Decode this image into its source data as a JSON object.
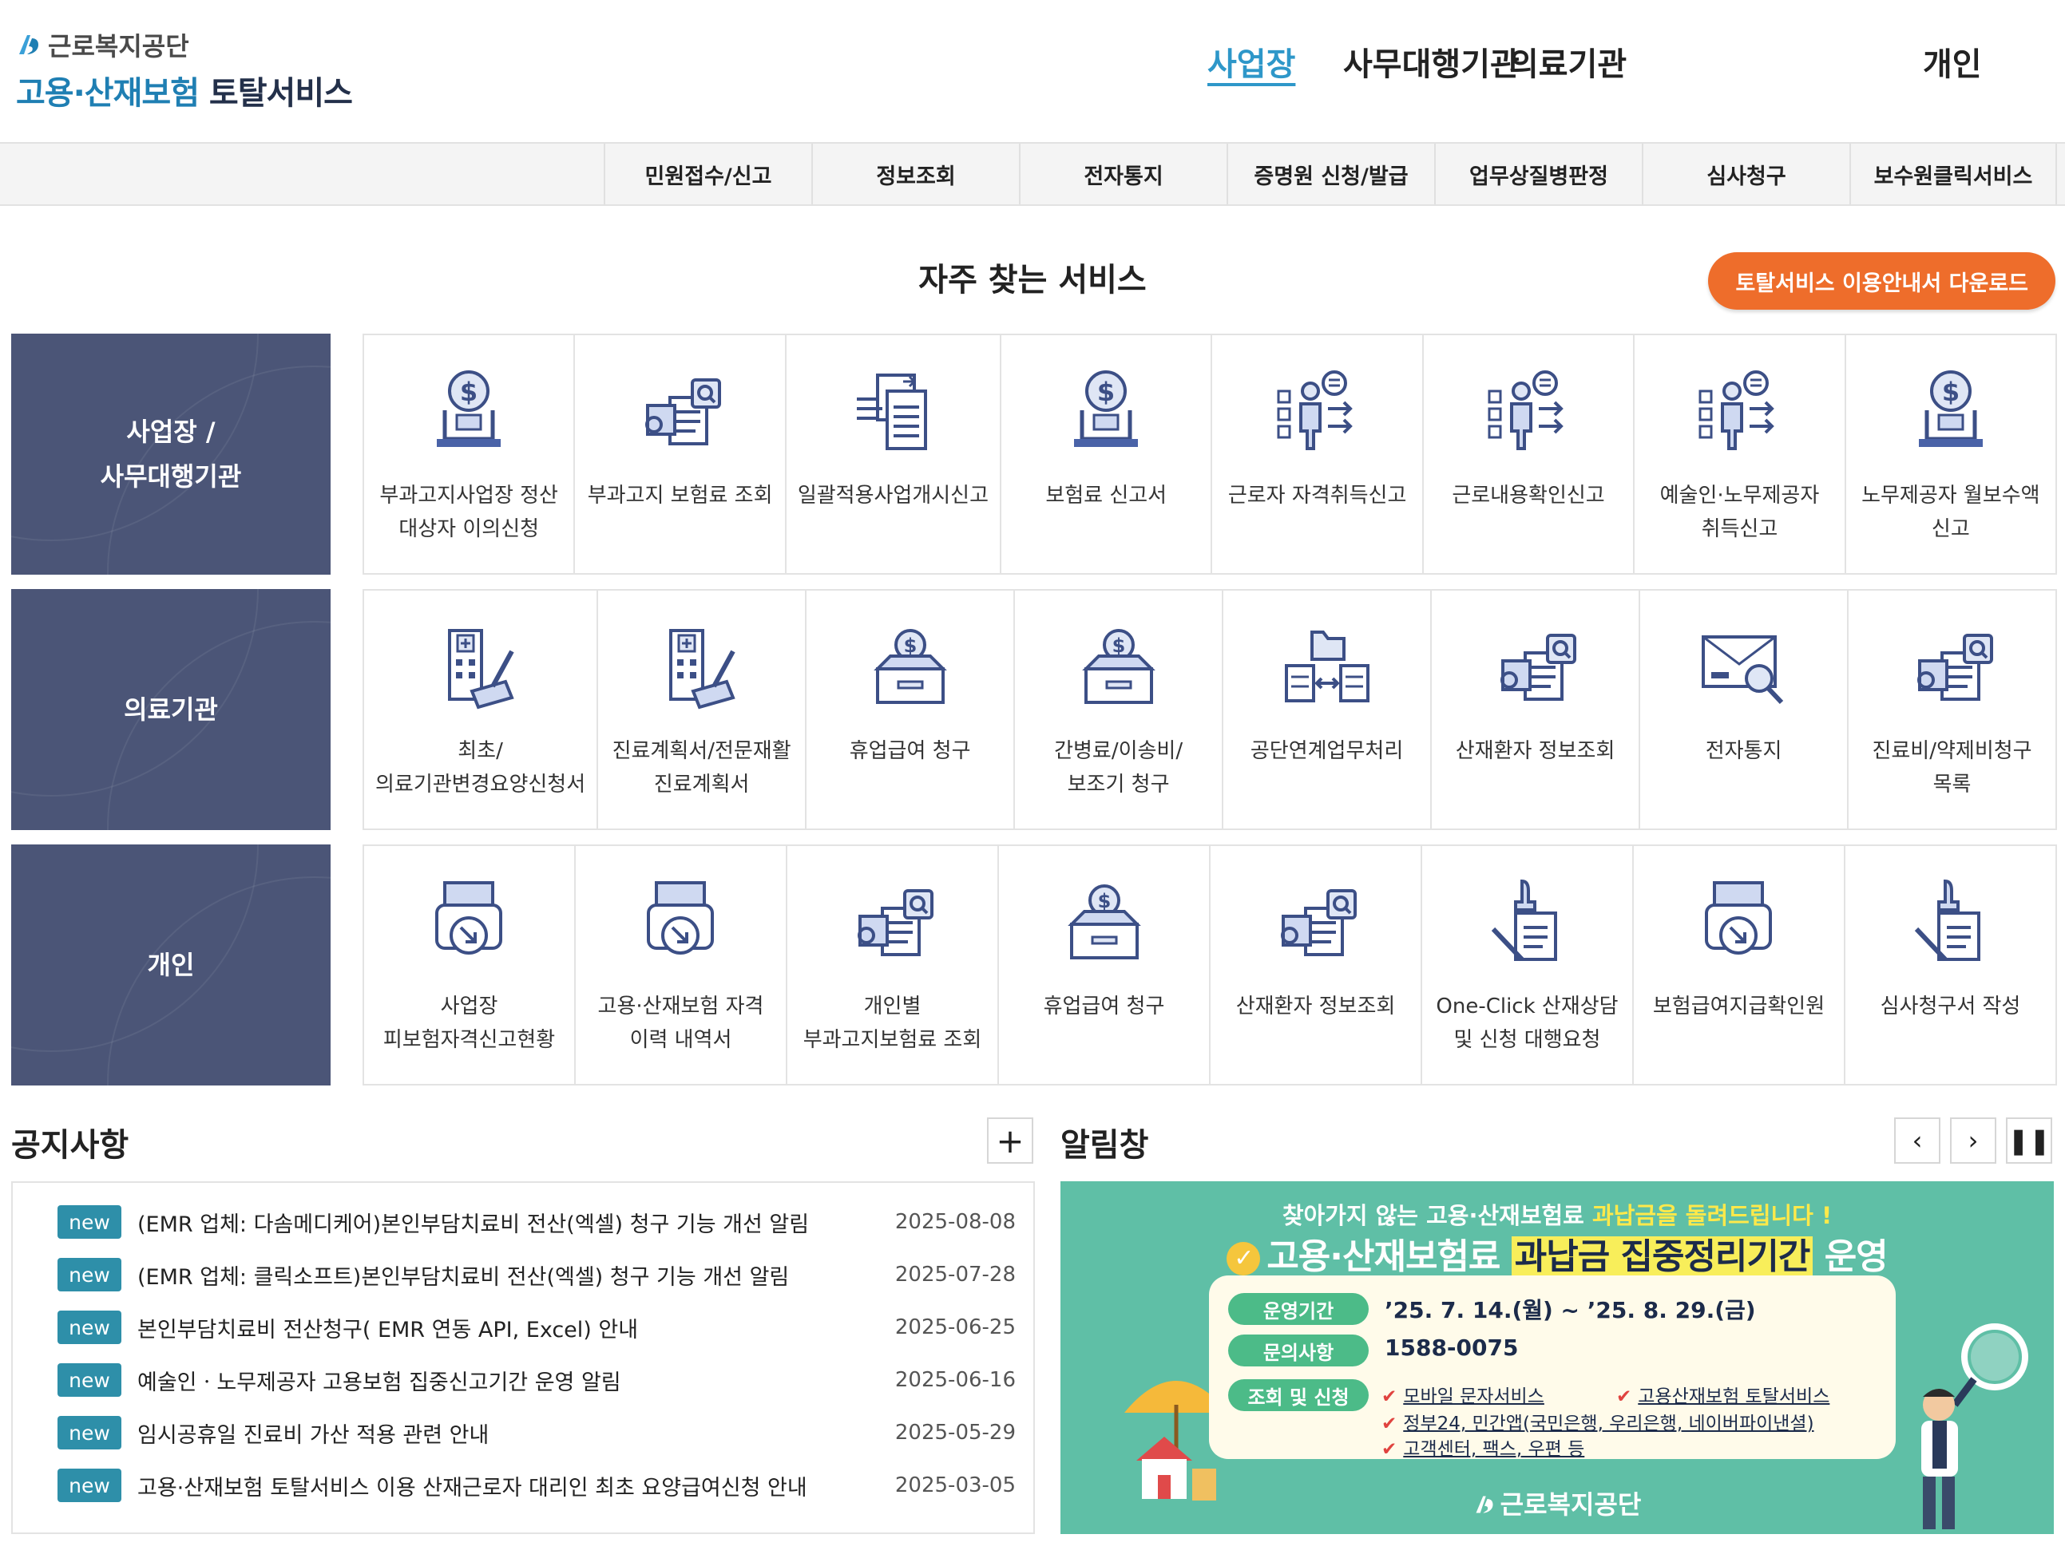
{
  "header": {
    "org_name": "근로복지공단",
    "service_name_blue": "고용·산재보험",
    "service_name_dark": " 토탈서비스",
    "top_nav": [
      {
        "label": "사업장",
        "active": true
      },
      {
        "label": "사무대행기관",
        "active": false
      },
      {
        "label": "의료기관",
        "active": false
      },
      {
        "label": "개인",
        "active": false
      }
    ],
    "sub_nav": [
      "민원접수/신고",
      "정보조회",
      "전자통지",
      "증명원 신청/발급",
      "업무상질병판정",
      "심사청구",
      "보수원클릭서비스"
    ]
  },
  "favorites": {
    "title": "자주 찾는 서비스",
    "download_label": "토탈서비스 이용안내서 다운로드",
    "rows": [
      {
        "label_line1": "사업장 /",
        "label_line2": "사무대행기관",
        "items": [
          {
            "label": "부과고지사업장 정산 대상자 이의신청",
            "icon": "money-laptop-icon"
          },
          {
            "label": "부과고지 보험료 조회",
            "icon": "document-search-icon"
          },
          {
            "label": "일괄적용사업개시신고",
            "icon": "document-stack-icon"
          },
          {
            "label": "보험료 신고서",
            "icon": "money-laptop-icon"
          },
          {
            "label": "근로자 자격취득신고",
            "icon": "person-arrows-icon"
          },
          {
            "label": "근로내용확인신고",
            "icon": "person-arrows-icon"
          },
          {
            "label": "예술인·노무제공자 취득신고",
            "icon": "person-arrows-icon"
          },
          {
            "label": "노무제공자 월보수액 신고",
            "icon": "money-laptop-icon"
          }
        ]
      },
      {
        "label_line1": "의료기관",
        "label_line2": "",
        "items": [
          {
            "label": "최초/의료기관변경요양신청서",
            "icon": "hospital-pen-icon"
          },
          {
            "label": "진료계획서/전문재활 진료계획서",
            "icon": "hospital-pen-icon"
          },
          {
            "label": "휴업급여 청구",
            "icon": "money-box-icon"
          },
          {
            "label": "간병료/이송비/보조기 청구",
            "icon": "money-box-icon"
          },
          {
            "label": "공단연계업무처리",
            "icon": "folder-exchange-icon"
          },
          {
            "label": "산재환자 정보조회",
            "icon": "document-search-icon"
          },
          {
            "label": "전자통지",
            "icon": "mail-search-icon"
          },
          {
            "label": "진료비/약제비청구 목록",
            "icon": "document-search-icon"
          }
        ]
      },
      {
        "label_line1": "개인",
        "label_line2": "",
        "items": [
          {
            "label": "사업장 피보험자격신고현황",
            "icon": "printer-arrow-icon"
          },
          {
            "label": "고용·산재보험 자격 이력 내역서",
            "icon": "printer-arrow-icon"
          },
          {
            "label": "개인별 부과고지보험료 조회",
            "icon": "document-search-icon"
          },
          {
            "label": "휴업급여 청구",
            "icon": "money-box-icon"
          },
          {
            "label": "산재환자 정보조회",
            "icon": "document-search-icon"
          },
          {
            "label": "One-Click 산재상담 및 신청 대행요청",
            "icon": "stamp-document-icon"
          },
          {
            "label": "보험급여지급확인원",
            "icon": "printer-arrow-icon"
          },
          {
            "label": "심사청구서 작성",
            "icon": "stamp-document-icon"
          }
        ]
      }
    ]
  },
  "notices": {
    "title": "공지사항",
    "badge": "new",
    "items": [
      {
        "text": "(EMR 업체: 다솜메디케어)본인부담치료비 전산(엑셀) 청구 기능 개선 알림",
        "date": "2025-08-08"
      },
      {
        "text": "(EMR 업체: 클릭소프트)본인부담치료비 전산(엑셀) 청구 기능 개선 알림",
        "date": "2025-07-28"
      },
      {
        "text": "본인부담치료비 전산청구( EMR 연동 API, Excel) 안내",
        "date": "2025-06-25"
      },
      {
        "text": "예술인ㆍ노무제공자 고용보험 집중신고기간 운영 알림",
        "date": "2025-06-16"
      },
      {
        "text": "임시공휴일 진료비 가산 적용 관련 안내",
        "date": "2025-05-29"
      },
      {
        "text": "고용·산재보험 토탈서비스 이용 산재근로자 대리인 최초 요양급여신청 안내",
        "date": "2025-03-05"
      }
    ]
  },
  "alerts": {
    "title": "알림창",
    "banner": {
      "sub_plain": "찾아가지 않는 고용·산재보험료 ",
      "sub_highlight": "과납금을 돌려드립니다 !",
      "main_plain": "고용·산재보험료 ",
      "main_highlight": "과납금 집중정리기간",
      "main_suffix": " 운영",
      "period_label": "운영기간",
      "period_value": "’25. 7. 14.(월) ~ ’25. 8. 29.(금)",
      "contact_label": "문의사항",
      "contact_value": "1588-0075",
      "apply_label": "조회 및 신청",
      "apply_items": [
        "모바일 문자서비스",
        "고용산재보험 토탈서비스",
        "정부24, 민간앱(국민은행, 우리은행, 네이버파이낸셜)",
        "고객센터, 팩스, 우편 등"
      ],
      "org": "근로복지공단"
    }
  },
  "colors": {
    "accent_blue": "#2e97c9",
    "row_label_bg": "#4b5577",
    "download_orange": "#ee6d2b",
    "badge_teal": "#2e8fa9",
    "banner_green": "#5fbfa6",
    "icon_blue": "#4a63a8"
  }
}
